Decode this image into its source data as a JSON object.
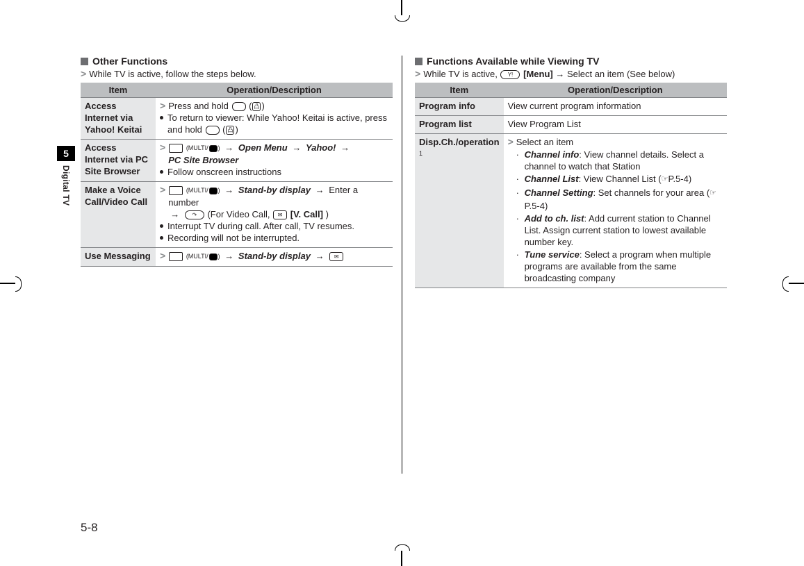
{
  "side_tab": {
    "number": "5",
    "label": "Digital TV"
  },
  "page_number": "5-8",
  "left": {
    "heading": "Other Functions",
    "intro": "While TV is active, follow the steps below.",
    "table_headers": {
      "item": "Item",
      "op": "Operation/Description"
    },
    "rows": [
      {
        "item": "Access Internet via Yahoo! Keitai",
        "op_main": "Press and hold ",
        "note": "To return to viewer: While Yahoo! Keitai is active, press and hold "
      },
      {
        "item": "Access Internet via PC Site Browser",
        "op_prefix_multi": "(MULTI/",
        "op_seq1": "Open Menu",
        "op_seq2": "Yahoo!",
        "op_seq3": "PC Site Browser",
        "note": "Follow onscreen instructions"
      },
      {
        "item": "Make a Voice Call/Video Call",
        "op_prefix_multi": "(MULTI/",
        "op_seq1": "Stand-by display",
        "op_tail": "Enter a number",
        "op_tail2_pre": "(For Video Call, ",
        "op_tail2_bold": "[V. Call]",
        "op_tail2_post": ")",
        "note1": "Interrupt TV during call. After call, TV resumes.",
        "note2": "Recording will not be interrupted."
      },
      {
        "item": "Use Messaging",
        "op_prefix_multi": "(MULTI/",
        "op_seq1": "Stand-by display"
      }
    ]
  },
  "right": {
    "heading": "Functions Available while Viewing TV",
    "intro_pre": "While TV is active, ",
    "intro_bold": "[Menu]",
    "intro_post": " → Select an item (See below)",
    "table_headers": {
      "item": "Item",
      "op": "Operation/Description"
    },
    "rows": [
      {
        "item": "Program info",
        "desc": "View current program information"
      },
      {
        "item": "Program list",
        "desc": "View Program List"
      },
      {
        "item": "Disp.Ch./operation",
        "item_sup": "1",
        "lead": "Select an item",
        "subitems": [
          {
            "term": "Channel info",
            "desc": ": View channel details. Select a channel to watch that Station"
          },
          {
            "term": "Channel List",
            "desc": ": View Channel List (",
            "ref": "P.5-4",
            "desc_post": ")"
          },
          {
            "term": "Channel Setting",
            "desc": ": Set channels for your area (",
            "ref": "P.5-4",
            "desc_post": ")"
          },
          {
            "term": "Add to ch. list",
            "desc": ": Add current station to Channel List. Assign current station to lowest available number key."
          },
          {
            "term": "Tune service",
            "desc": ": Select a program when multiple programs are available from the same broadcasting company"
          }
        ]
      }
    ]
  }
}
